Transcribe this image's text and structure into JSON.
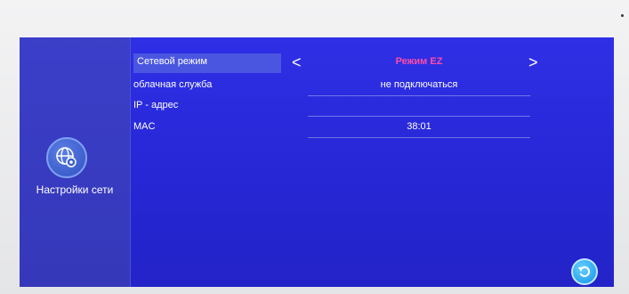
{
  "sidebar": {
    "icon": "network-settings-icon",
    "label": "Настройки сети"
  },
  "settings": {
    "network_mode": {
      "label": "Сетевой режим",
      "value": "Режим EZ",
      "value_color": "#ff4da6"
    },
    "cloud_service": {
      "label": "облачная служба",
      "value": "не подключаться"
    },
    "ip_address": {
      "label": "IP - адрес",
      "value": ""
    },
    "mac": {
      "label": "MAC",
      "value": "38:01"
    }
  },
  "controls": {
    "prev_arrow": "<",
    "next_arrow": ">",
    "back_icon": "back-arrow-icon"
  },
  "colors": {
    "screen_bg": "#2727d6",
    "sidebar_bg": "#3538b8",
    "selected_row_bg": "#4a56df"
  }
}
